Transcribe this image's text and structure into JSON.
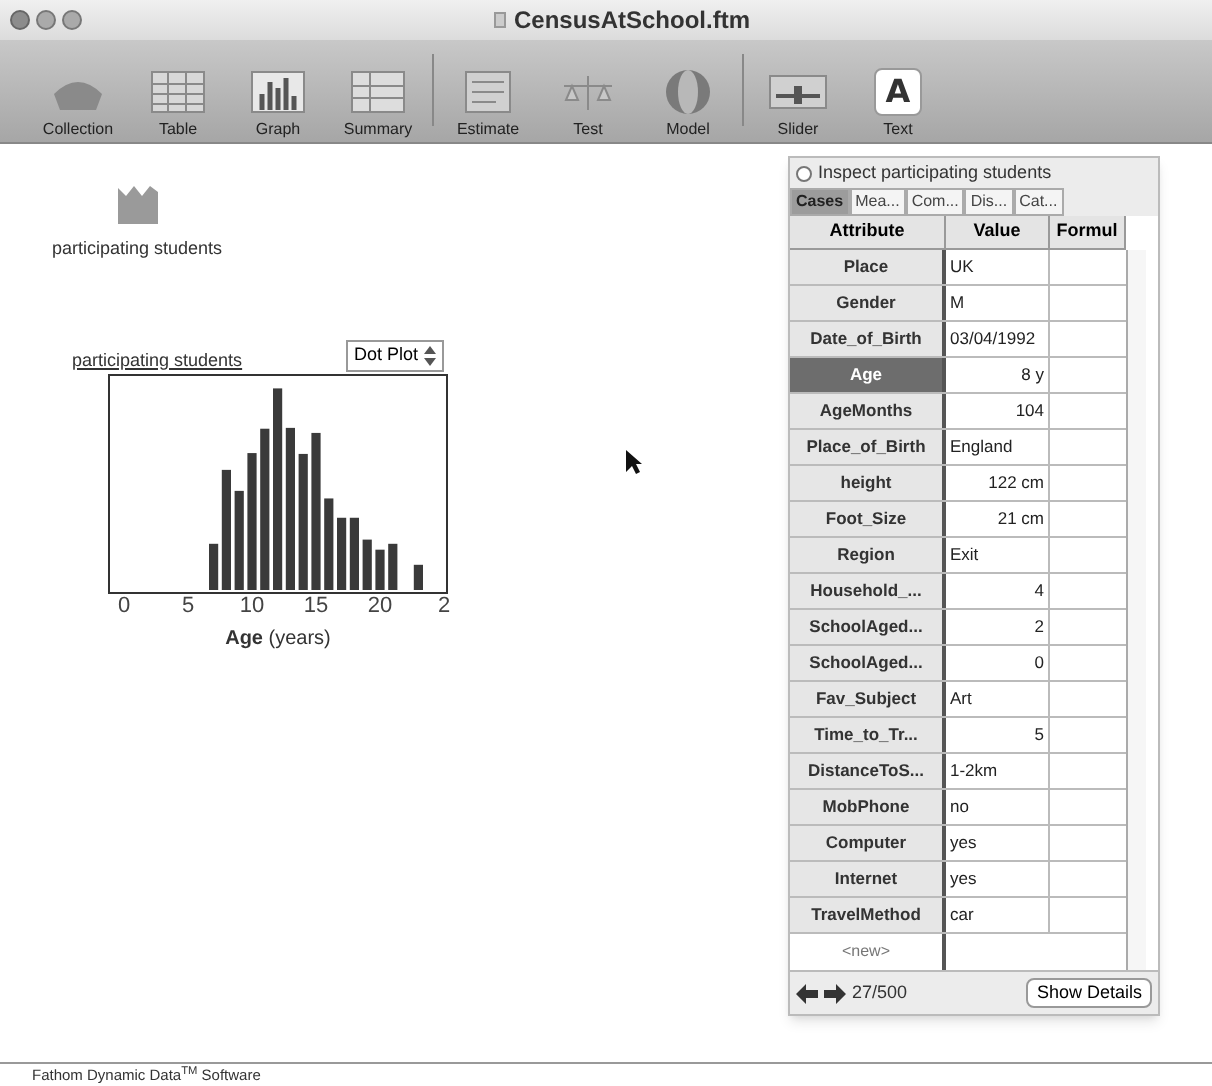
{
  "window": {
    "title": "CensusAtSchool.ftm"
  },
  "toolbar": [
    {
      "label": "Collection",
      "kind": "collection"
    },
    {
      "label": "Table",
      "kind": "table"
    },
    {
      "label": "Graph",
      "kind": "graph"
    },
    {
      "label": "Summary",
      "kind": "summary"
    },
    {
      "label": "Estimate",
      "kind": "estimate"
    },
    {
      "label": "Test",
      "kind": "test"
    },
    {
      "label": "Model",
      "kind": "model"
    },
    {
      "label": "Slider",
      "kind": "slider"
    },
    {
      "label": "Text",
      "kind": "text",
      "glyph": "A"
    }
  ],
  "collection": {
    "name": "participating students"
  },
  "graph": {
    "title": "participating students",
    "plot_type": "Dot Plot",
    "x_ticks": [
      "0",
      "5",
      "10",
      "15",
      "20",
      "2"
    ],
    "x_label": "**Age** (years)"
  },
  "inspector": {
    "title": "Inspect participating students",
    "tabs": [
      {
        "label": "Cases",
        "selected": true
      },
      {
        "label": "Mea...",
        "selected": false
      },
      {
        "label": "Com...",
        "selected": false
      },
      {
        "label": "Dis...",
        "selected": false
      },
      {
        "label": "Cat...",
        "selected": false
      }
    ],
    "columns": [
      "Attribute",
      "Value",
      "Formul"
    ],
    "rows": [
      {
        "attribute": "Place",
        "value": "UK",
        "kind": "text",
        "selected": false
      },
      {
        "attribute": "Gender",
        "value": "M",
        "kind": "text",
        "selected": false
      },
      {
        "attribute": "Date_of_Birth",
        "value": "03/04/1992",
        "kind": "text",
        "selected": false
      },
      {
        "attribute": "Age",
        "value": "8 y",
        "kind": "number",
        "selected": true
      },
      {
        "attribute": "AgeMonths",
        "value": "104",
        "kind": "number",
        "selected": false
      },
      {
        "attribute": "Place_of_Birth",
        "value": "England",
        "kind": "text",
        "selected": false
      },
      {
        "attribute": "height",
        "value": "122 cm",
        "kind": "number",
        "selected": false
      },
      {
        "attribute": "Foot_Size",
        "value": "21 cm",
        "kind": "number",
        "selected": false
      },
      {
        "attribute": "Region",
        "value": "Exit",
        "kind": "text",
        "selected": false
      },
      {
        "attribute": "Household_...",
        "value": "4",
        "kind": "number",
        "selected": false
      },
      {
        "attribute": "SchoolAged...",
        "value": "2",
        "kind": "number",
        "selected": false
      },
      {
        "attribute": "SchoolAged...",
        "value": "0",
        "kind": "number",
        "selected": false
      },
      {
        "attribute": "Fav_Subject",
        "value": "Art",
        "kind": "text",
        "selected": false
      },
      {
        "attribute": "Time_to_Tr...",
        "value": "5",
        "kind": "number",
        "selected": false
      },
      {
        "attribute": "DistanceToS...",
        "value": "1-2km",
        "kind": "text",
        "selected": false
      },
      {
        "attribute": "MobPhone",
        "value": "no",
        "kind": "text",
        "selected": false
      },
      {
        "attribute": "Computer",
        "value": "yes",
        "kind": "text",
        "selected": false
      },
      {
        "attribute": "Internet",
        "value": "yes",
        "kind": "text",
        "selected": false
      },
      {
        "attribute": "TravelMethod",
        "value": "car",
        "kind": "text",
        "selected": false
      }
    ],
    "new_row": "<new>",
    "case_counter": "27/500",
    "details_button": "Show Details"
  },
  "footer": "Fathom Dynamic Data$^{TM}$ Software"
}
